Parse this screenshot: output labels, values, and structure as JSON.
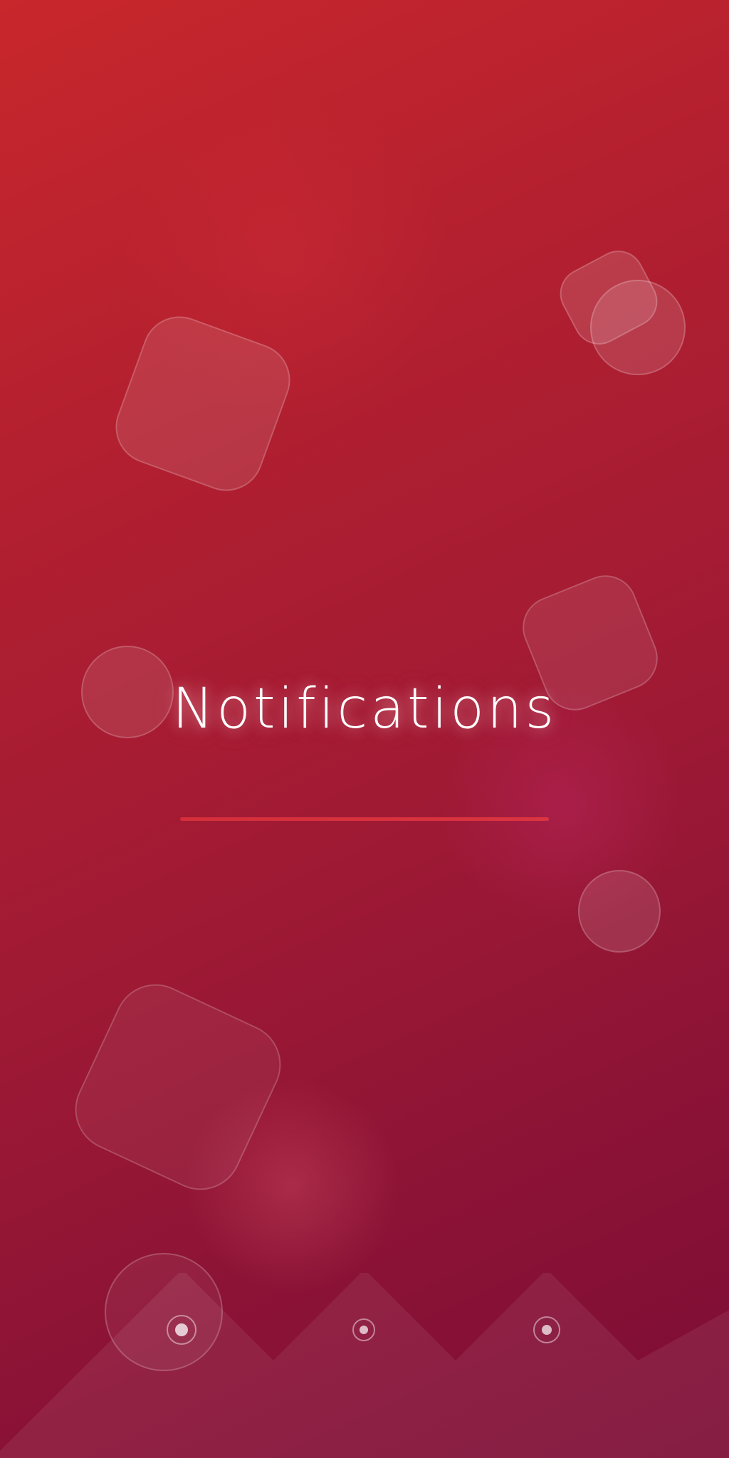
{
  "screen": {
    "title": "Notifications"
  },
  "pagination": {
    "total_pages": 3,
    "active_page": 1
  },
  "colors": {
    "background_top": "#c8272c",
    "background_bottom": "#7c0c35",
    "title_text": "#ffffff",
    "divider": "#d8323c"
  }
}
